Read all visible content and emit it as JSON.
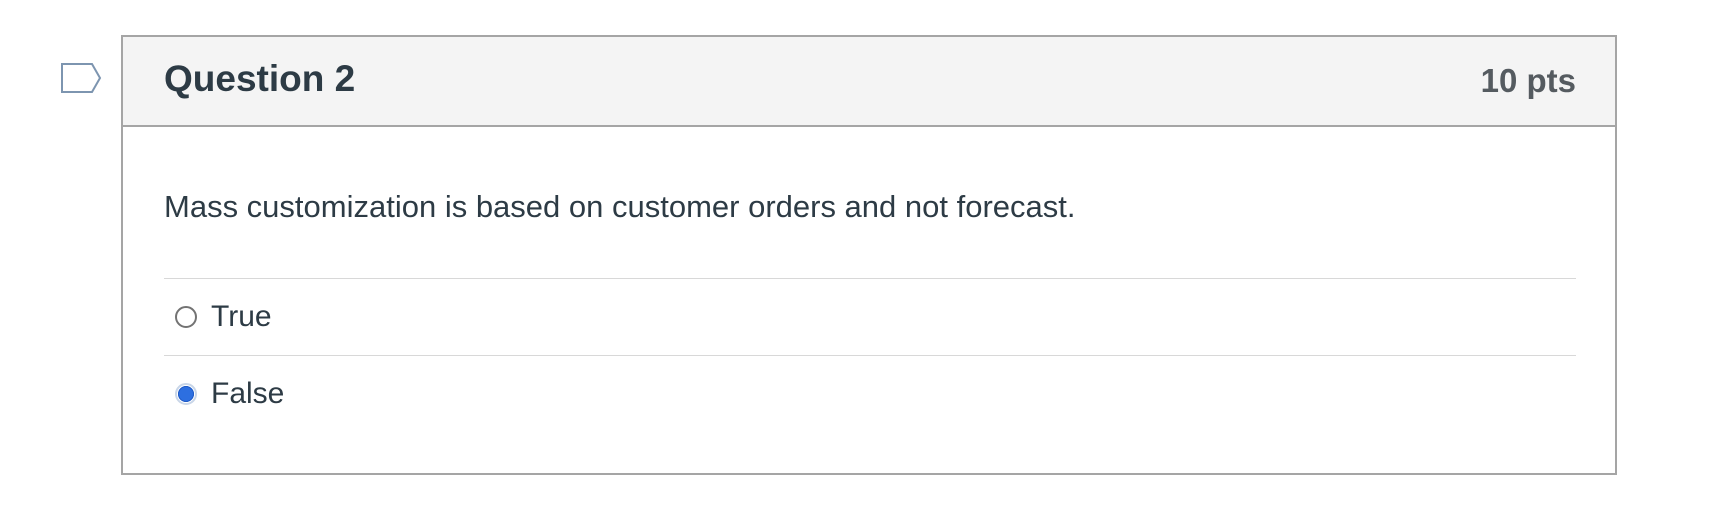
{
  "question": {
    "title": "Question 2",
    "points": "10 pts",
    "text": "Mass customization is based on customer orders and not forecast.",
    "flag_icon": "flag-icon",
    "answers": [
      {
        "label": "True",
        "selected": false
      },
      {
        "label": "False",
        "selected": true
      }
    ]
  },
  "colors": {
    "header_bg": "#f4f4f4",
    "border": "#a5a5a5",
    "selected_radio": "#2d6fe0",
    "text": "#2d3b45"
  }
}
